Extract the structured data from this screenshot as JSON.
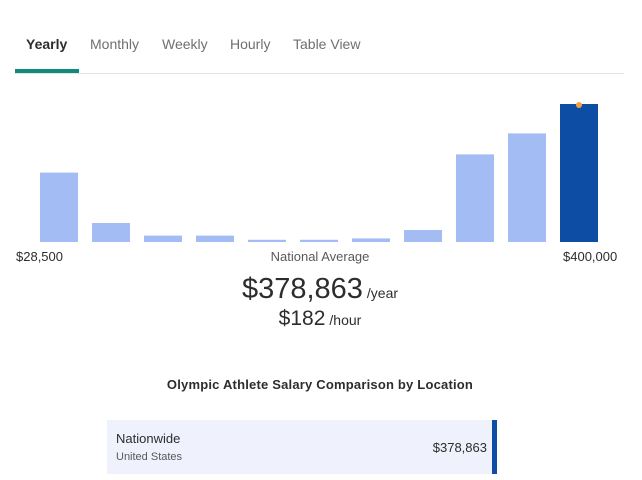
{
  "tabs": [
    {
      "label": "Yearly",
      "active": true
    },
    {
      "label": "Monthly",
      "active": false
    },
    {
      "label": "Weekly",
      "active": false
    },
    {
      "label": "Hourly",
      "active": false
    },
    {
      "label": "Table View",
      "active": false
    }
  ],
  "chart_data": {
    "type": "bar",
    "title": "",
    "bar_heights_relative": [
      0.51,
      0.15,
      0.06,
      0.06,
      0.03,
      0.03,
      0.04,
      0.1,
      0.64,
      0.79,
      1.0
    ],
    "highlight_index": 10,
    "x_min_label": "$28,500",
    "x_max_label": "$400,000",
    "marker_label": "National Average",
    "colors": {
      "bar": "#a3bcf3",
      "highlight": "#0e4da4",
      "marker": "#f2a14b"
    }
  },
  "salary": {
    "yearly_value": "$378,863",
    "yearly_unit": "/year",
    "hourly_value": "$182",
    "hourly_unit": "/hour"
  },
  "comparison": {
    "title": "Olympic Athlete Salary Comparison by Location",
    "rows": [
      {
        "name": "Nationwide",
        "country": "United States",
        "value": "$378,863"
      }
    ]
  }
}
